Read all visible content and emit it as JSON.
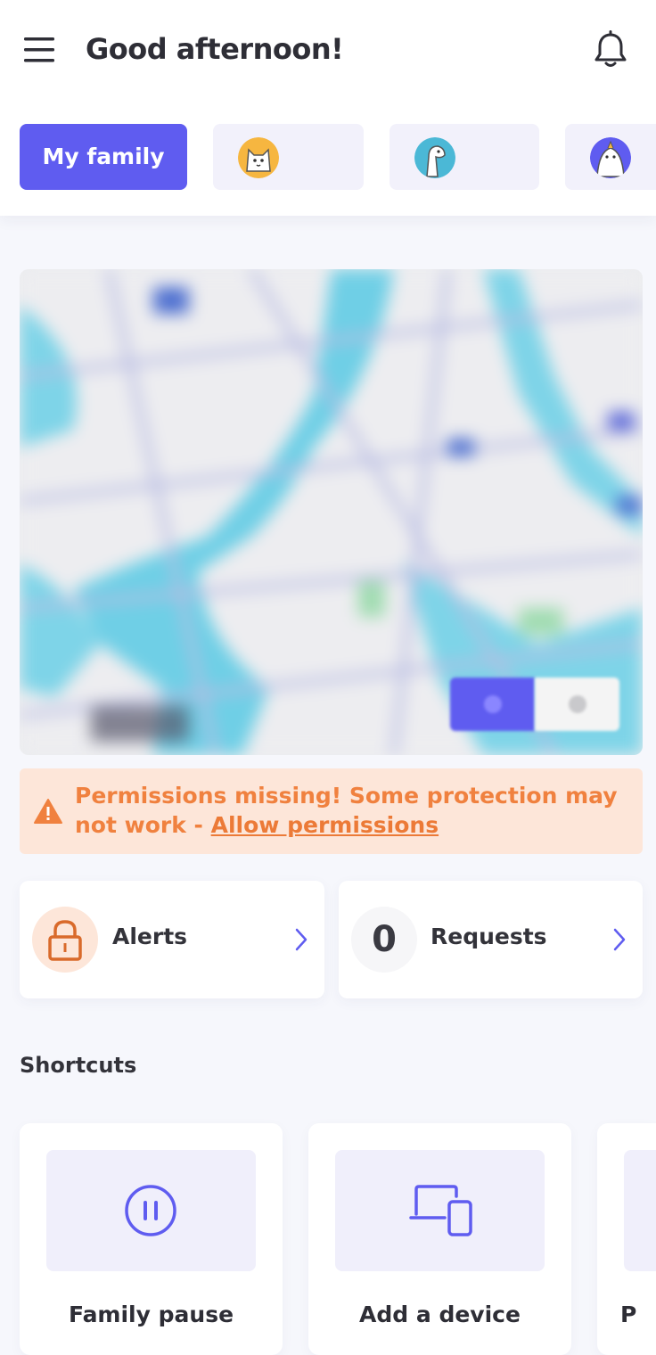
{
  "header": {
    "greeting": "Good afternoon!",
    "menu_icon": "hamburger-menu-icon",
    "notification_icon": "bell-icon"
  },
  "tabs": [
    {
      "label": "My family",
      "active": true
    },
    {
      "avatar": "cat-avatar",
      "active": false
    },
    {
      "avatar": "horse-avatar",
      "active": false
    },
    {
      "avatar": "bird-avatar",
      "active": false
    }
  ],
  "map": {
    "toggle_icons": [
      "location-icon",
      "layers-icon"
    ]
  },
  "warning": {
    "message": "Permissions missing! Some protection may not work - ",
    "link": "Allow permissions",
    "icon": "warning-triangle-icon"
  },
  "cards": {
    "alerts": {
      "label": "Alerts",
      "icon": "lock-icon"
    },
    "requests": {
      "label": "Requests",
      "count": "0"
    }
  },
  "shortcuts": {
    "title": "Shortcuts",
    "items": [
      {
        "label": "Family pause",
        "icon": "pause-circle-icon"
      },
      {
        "label": "Add a device",
        "icon": "devices-icon"
      },
      {
        "label": "P",
        "icon": "partial-icon"
      }
    ]
  },
  "colors": {
    "accent": "#5f5cf0",
    "warning_bg": "#fde6d9",
    "warning_text": "#f0813f",
    "background": "#f6f7fc"
  }
}
